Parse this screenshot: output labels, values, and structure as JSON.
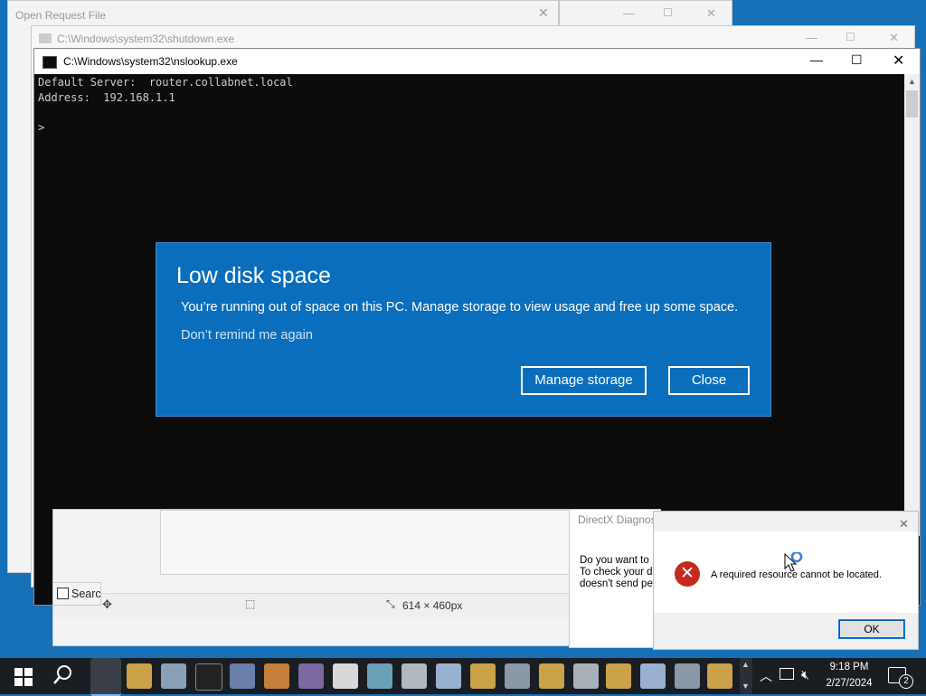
{
  "windows": {
    "open_request": {
      "title": "Open Request File"
    },
    "shutdown": {
      "title": "C:\\Windows\\system32\\shutdown.exe"
    },
    "nslookup": {
      "title": "C:\\Windows\\system32\\nslookup.exe"
    }
  },
  "console": {
    "line1": "Default Server:  router.collabnet.local",
    "line2": "Address:  192.168.1.1",
    "prompt": ">"
  },
  "toast": {
    "title": "Low disk space",
    "message": "You’re running out of space on this PC. Manage storage to view usage and free up some space.",
    "link": "Don’t remind me again",
    "manage_btn": "Manage storage",
    "close_btn": "Close"
  },
  "editor_status": {
    "search": "Searc",
    "size": "614 × 460px"
  },
  "directx": {
    "title": "DirectX Diagnos",
    "line1": "Do you want to",
    "line2": "To check your d",
    "line3": "doesn't send pe"
  },
  "error_dialog": {
    "message": "A required resource cannot be located.",
    "ok": "OK"
  },
  "taskbar": {
    "time": "9:18 PM",
    "date": "2/27/2024",
    "notifications": "2"
  },
  "colors": {
    "desktop": "#1670b8",
    "toast_bg": "#0a6ebd",
    "error_red": "#c42b1c",
    "taskbar": "#1a1d22"
  }
}
